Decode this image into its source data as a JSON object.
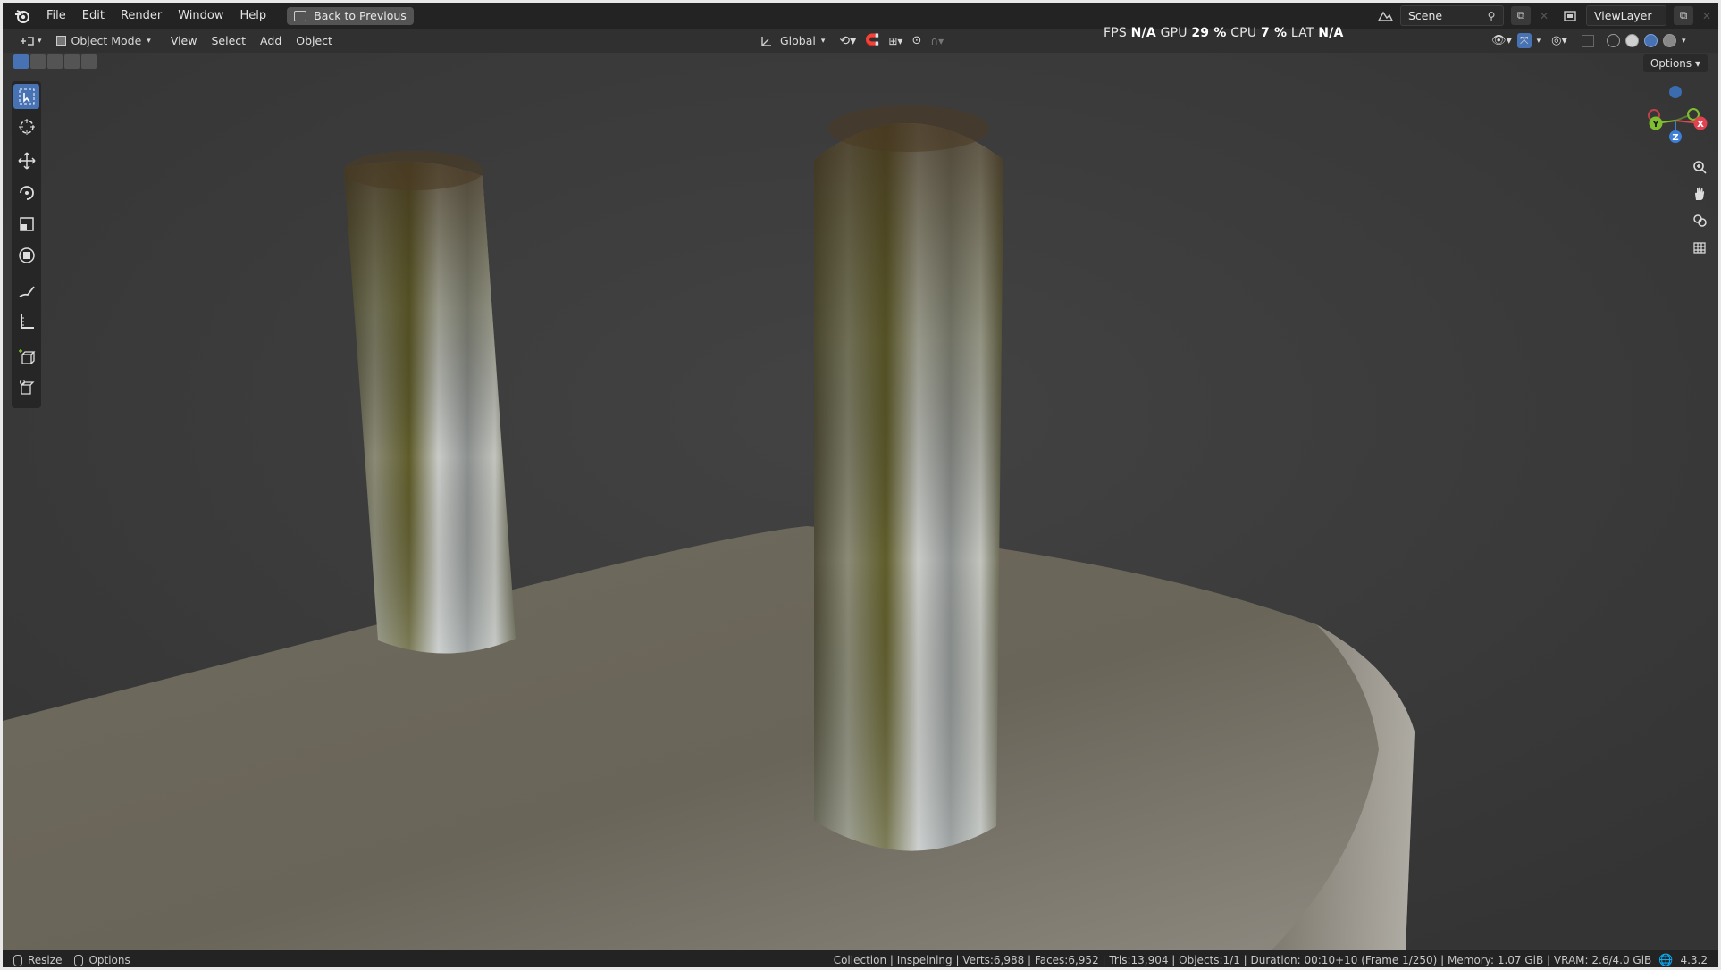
{
  "menu": {
    "items": [
      "File",
      "Edit",
      "Render",
      "Window",
      "Help"
    ],
    "back_button": "Back to Previous"
  },
  "topbar_right": {
    "scene_label": "Scene",
    "view_layer_label": "ViewLayer"
  },
  "header": {
    "mode": "Object Mode",
    "menus": [
      "View",
      "Select",
      "Add",
      "Object"
    ],
    "transform_orientation": "Global",
    "options_label": "Options"
  },
  "stats_overlay": {
    "fps_label": "FPS",
    "fps_value": "N/A",
    "gpu_label": "GPU",
    "gpu_value": "29 %",
    "cpu_label": "CPU",
    "cpu_value": "7 %",
    "lat_label": "LAT",
    "lat_value": "N/A"
  },
  "gizmo": {
    "x": "X",
    "y": "Y",
    "z": "Z"
  },
  "statusbar": {
    "left_action_1": "Resize",
    "left_action_2": "Options",
    "info": "Collection | Inspelning | Verts:6,988 | Faces:6,952 | Tris:13,904 | Objects:1/1 | Duration: 00:10+10 (Frame 1/250) | Memory: 1.07 GiB | VRAM: 2.6/4.0 GiB",
    "version": "4.3.2"
  },
  "colors": {
    "accent": "#4772b3",
    "background": "#303030",
    "gizmo_x": "#e0434f",
    "gizmo_y": "#7fbf2f",
    "gizmo_z": "#3d7fd8"
  }
}
